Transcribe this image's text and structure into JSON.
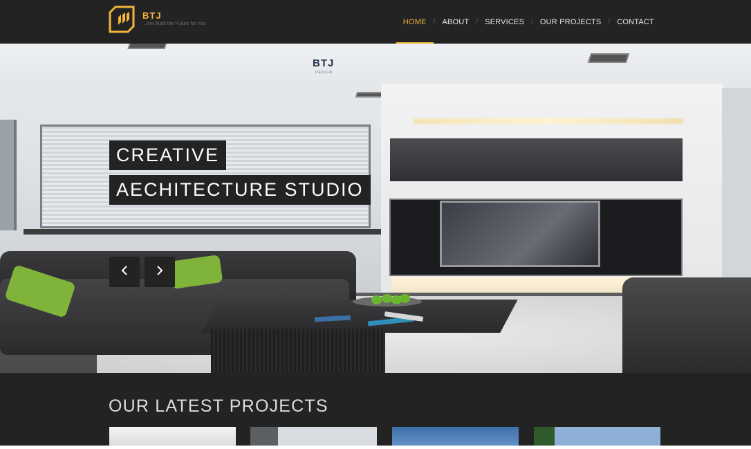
{
  "brand": {
    "name": "BTJ",
    "tagline": "...We Build the Future for You"
  },
  "nav": {
    "items": [
      {
        "label": "HOME",
        "active": true
      },
      {
        "label": "ABOUT",
        "active": false
      },
      {
        "label": "SERVICES",
        "active": false
      },
      {
        "label": "OUR PROJECTS",
        "active": false
      },
      {
        "label": "CONTACT",
        "active": false
      }
    ],
    "separator": "/"
  },
  "hero": {
    "line1": "CREATIVE",
    "line2": "AECHITECTURE STUDIO",
    "prev_icon": "chevron-left-icon",
    "next_icon": "chevron-right-icon"
  },
  "projects": {
    "title": "OUR LATEST PROJECTS",
    "thumb_sign": "BTJ",
    "thumb_sign_sub": "DESIGN"
  },
  "colors": {
    "accent": "#f0b53a",
    "background": "#232323",
    "text": "#e8e8e8"
  }
}
